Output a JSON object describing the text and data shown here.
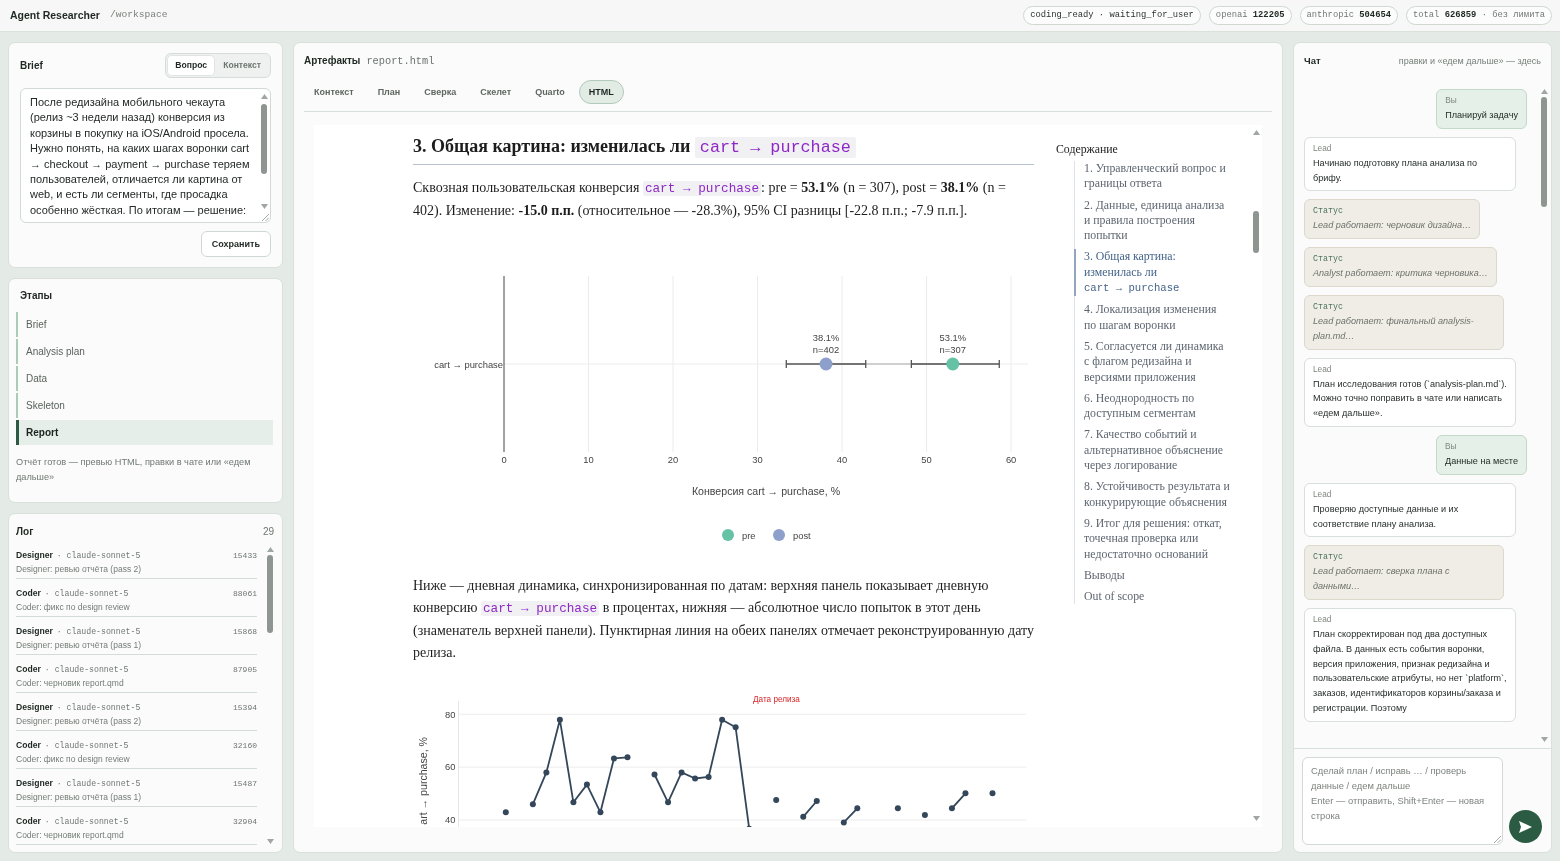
{
  "topbar": {
    "title": "Agent Researcher",
    "path": "/workspace",
    "badges": [
      {
        "kind": "status",
        "text": "coding_ready · waiting_for_user"
      },
      {
        "kind": "tokens",
        "text": "openai **122205**"
      },
      {
        "kind": "tokens",
        "text": "anthropic **504654**"
      },
      {
        "kind": "tokens",
        "text": "total **626859** · без лимита"
      }
    ]
  },
  "brief": {
    "title": "Brief",
    "tabs": [
      {
        "label": "Вопрос",
        "selected": true
      },
      {
        "label": "Контекст",
        "selected": false
      }
    ],
    "text": "После редизайна мобильного чекаута (релиз ~3 недели назад) конверсия из корзины в покупку на iOS/Android просела. Нужно понять, на каких шагах воронки cart → checkout → payment → purchase теряем пользователей, отличается ли картина от web, и есть ли сегменты, где просадка особенно жёсткая. По итогам — решение:",
    "save_button": "Сохранить"
  },
  "stages": {
    "title": "Этапы",
    "items": [
      {
        "label": "Brief",
        "selected": false
      },
      {
        "label": "Analysis plan",
        "selected": false
      },
      {
        "label": "Data",
        "selected": false
      },
      {
        "label": "Skeleton",
        "selected": false
      },
      {
        "label": "Report",
        "selected": true
      }
    ],
    "note": "Отчёт готов — превью HTML, правки в чате или «едем дальше»"
  },
  "log": {
    "title": "Лог",
    "count": "29",
    "entries": [
      {
        "role": "Designer",
        "model": "· claude-sonnet-5",
        "tokens": "15433",
        "title": "Designer: ревью отчёта (pass 2)"
      },
      {
        "role": "Coder",
        "model": "· claude-sonnet-5",
        "tokens": "88061",
        "title": "Coder: фикс по design review"
      },
      {
        "role": "Designer",
        "model": "· claude-sonnet-5",
        "tokens": "15868",
        "title": "Designer: ревью отчёта (pass 1)"
      },
      {
        "role": "Coder",
        "model": "· claude-sonnet-5",
        "tokens": "87905",
        "title": "Coder: черновик report.qmd"
      },
      {
        "role": "Designer",
        "model": "· claude-sonnet-5",
        "tokens": "15394",
        "title": "Designer: ревью отчёта (pass 2)"
      },
      {
        "role": "Coder",
        "model": "· claude-sonnet-5",
        "tokens": "32160",
        "title": "Coder: фикс по design review"
      },
      {
        "role": "Designer",
        "model": "· claude-sonnet-5",
        "tokens": "15487",
        "title": "Designer: ревью отчёта (pass 1)"
      },
      {
        "role": "Coder",
        "model": "· claude-sonnet-5",
        "tokens": "32904",
        "title": "Coder: черновик report.qmd"
      }
    ]
  },
  "artifacts": {
    "title": "Артефакты",
    "file": "report.html",
    "tabs": [
      {
        "label": "Контекст",
        "selected": false
      },
      {
        "label": "План",
        "selected": false
      },
      {
        "label": "Сверка",
        "selected": false
      },
      {
        "label": "Скелет",
        "selected": false
      },
      {
        "label": "Quarto",
        "selected": false
      },
      {
        "label": "HTML",
        "selected": true
      }
    ],
    "report": {
      "blocks": [
        {
          "kind": "heading",
          "parts": [
            {
              "kind": "text",
              "text": "3. Общая картина: изменилась ли "
            },
            {
              "kind": "code",
              "text": "cart → purchase"
            }
          ]
        },
        {
          "kind": "paragraph",
          "parts": [
            {
              "kind": "text",
              "text": "Сквозная пользовательская конверсия "
            },
            {
              "kind": "code",
              "text": "cart → purchase"
            },
            {
              "kind": "text",
              "text": ": pre = **53.1%** (n = 307), post = **38.1%** (n = 402). Изменение: **-15.0 п.п.** (относительное — -28.3%), 95% CI разницы [-22.8 п.п.; -7.9 п.п.]."
            }
          ]
        },
        {
          "kind": "chart",
          "chart_data": {
            "type": "scatter",
            "orientation": "horizontal",
            "xlabel": "Конверсия cart → purchase, %",
            "categories": [
              "cart → purchase"
            ],
            "xlim": [
              0,
              62
            ],
            "xticks": [
              0,
              10,
              20,
              30,
              40,
              50,
              60
            ],
            "grid": true,
            "legend": "bottom",
            "series": [
              {
                "name": "pre",
                "color": "#66c2a5",
                "values": [
                  53.1
                ],
                "errors": [
                  [
                    48.2,
                    58.6
                  ]
                ]
              },
              {
                "name": "post",
                "color": "#8da0cb",
                "values": [
                  38.1
                ],
                "errors": [
                  [
                    33.4,
                    42.8
                  ]
                ]
              }
            ],
            "annotations": [
              {
                "text": "38.1%\nn=402",
                "x": 38.1,
                "y": "cart → purchase"
              },
              {
                "text": "53.1%\nn=307",
                "x": 53.1,
                "y": "cart → purchase"
              }
            ]
          }
        },
        {
          "kind": "paragraph",
          "parts": [
            {
              "kind": "text",
              "text": "Ниже — дневная динамика, синхронизированная по датам: верхняя панель показывает дневную конверсию "
            },
            {
              "kind": "code",
              "text": "cart → purchase"
            },
            {
              "kind": "text",
              "text": " в процентах, нижняя — абсолютное число попыток в этот день (знаменатель верхней панели). Пунктирная линия на обеих панелях отмечает реконструированную дату релиза."
            }
          ]
        },
        {
          "kind": "chart",
          "chart_data": {
            "type": "line",
            "ylabel": "art → purchase, %",
            "ylim": [
              36.6,
              85
            ],
            "yticks": [
              40,
              60,
              80
            ],
            "grid": true,
            "marker": "circle",
            "values": [
              null,
              null,
              null,
              42.9,
              null,
              46.0,
              58.0,
              77.9,
              46.7,
              53.4,
              42.9,
              63.3,
              63.7,
              null,
              57.2,
              46.7,
              58.0,
              55.7,
              56.3,
              77.9,
              75.1,
              36.7,
              null,
              47.6,
              null,
              41.2,
              47.2,
              null,
              39.1,
              44.4,
              null,
              null,
              44.4,
              null,
              41.9,
              null,
              44.4,
              50.1,
              null,
              50.1,
              null,
              null
            ],
            "annotations": [
              "Дата релиза"
            ]
          }
        }
      ],
      "toc": {
        "title": "Содержание",
        "items": [
          {
            "selected": false,
            "parts": [
              {
                "kind": "text",
                "text": "1. Управленческий вопрос и границы ответа"
              }
            ]
          },
          {
            "selected": false,
            "parts": [
              {
                "kind": "text",
                "text": "2. Данные, единица анализа и правила построения попытки"
              }
            ]
          },
          {
            "selected": true,
            "parts": [
              {
                "kind": "text",
                "text": "3. Общая картина: изменилась ли "
              },
              {
                "kind": "code",
                "text": "cart → purchase"
              }
            ]
          },
          {
            "selected": false,
            "parts": [
              {
                "kind": "text",
                "text": "4. Локализация изменения по шагам воронки"
              }
            ]
          },
          {
            "selected": false,
            "parts": [
              {
                "kind": "text",
                "text": "5. Согласуется ли динамика с флагом редизайна и версиями приложения"
              }
            ]
          },
          {
            "selected": false,
            "parts": [
              {
                "kind": "text",
                "text": "6. Неоднородность по доступным сегментам"
              }
            ]
          },
          {
            "selected": false,
            "parts": [
              {
                "kind": "text",
                "text": "7. Качество событий и альтернативное объяснение через логирование"
              }
            ]
          },
          {
            "selected": false,
            "parts": [
              {
                "kind": "text",
                "text": "8. Устойчивость результата и конкурирующие объяснения"
              }
            ]
          },
          {
            "selected": false,
            "parts": [
              {
                "kind": "text",
                "text": "9. Итог для решения: откат, точечная проверка или недостаточно оснований"
              }
            ]
          },
          {
            "selected": false,
            "parts": [
              {
                "kind": "text",
                "text": "Выводы"
              }
            ]
          },
          {
            "selected": false,
            "parts": [
              {
                "kind": "text",
                "text": "Out of scope"
              }
            ]
          }
        ]
      }
    }
  },
  "chat": {
    "title": "Чат",
    "hint": "правки и «едем дальше» — здесь",
    "messages": [
      {
        "kind": "user",
        "author": "Вы",
        "text": "Планируй задачу"
      },
      {
        "kind": "lead",
        "author": "Lead",
        "text": "Начинаю подготовку плана анализа по брифу."
      },
      {
        "kind": "status",
        "author": "Статус",
        "text": "Lead работает: черновик дизайна…"
      },
      {
        "kind": "status",
        "author": "Статус",
        "text": "Analyst работает: критика черновика…"
      },
      {
        "kind": "status",
        "author": "Статус",
        "text": "Lead работает: финальный analysis-plan.md…"
      },
      {
        "kind": "lead",
        "author": "Lead",
        "text": "План исследования готов (`analysis-plan.md`). Можно точно поправить в чате или написать «едем дальше»."
      },
      {
        "kind": "user",
        "author": "Вы",
        "text": "Данные на месте"
      },
      {
        "kind": "lead",
        "author": "Lead",
        "text": "Проверяю доступные данные и их соответствие плану анализа."
      },
      {
        "kind": "status",
        "author": "Статус",
        "text": "Lead работает: сверка плана с данными…"
      },
      {
        "kind": "lead",
        "author": "Lead",
        "text": "План скорректирован под два доступных файла. В данных есть события воронки, версия приложения, признак редизайна и пользовательские атрибуты, но нет `platform`, заказов, идентификаторов корзины/заказа и регистрации. Поэтому"
      }
    ],
    "input": {
      "placeholder": "Сделай план / исправь … / проверь данные / едем дальше\nEnter — отправить, Shift+Enter — новая строка"
    }
  }
}
